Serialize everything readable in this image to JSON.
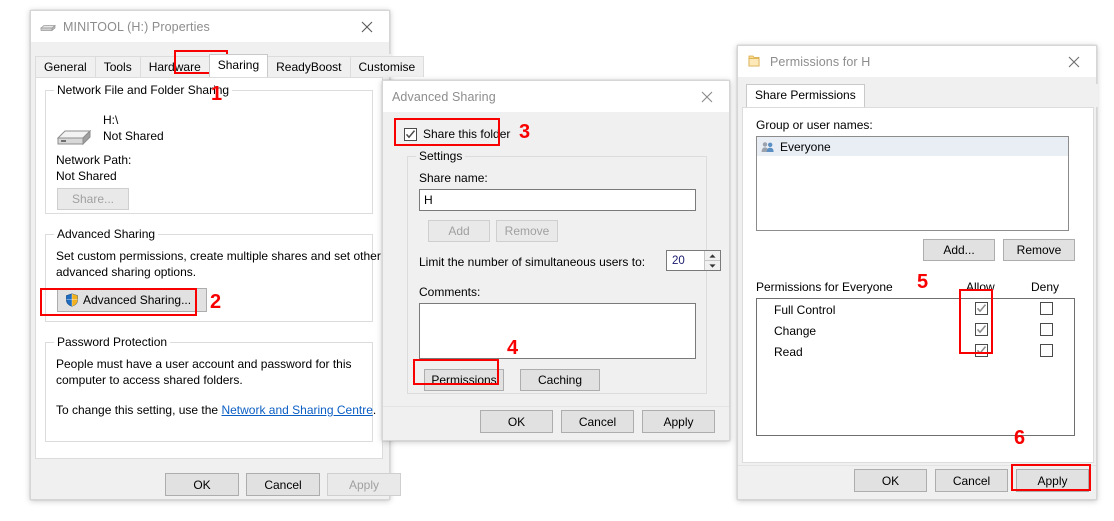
{
  "properties_window": {
    "title": "MINITOOL (H:) Properties",
    "title_icon": "drive-icon",
    "close_icon": "close-icon",
    "tabs": [
      {
        "label": "General",
        "selected": false
      },
      {
        "label": "Tools",
        "selected": false
      },
      {
        "label": "Hardware",
        "selected": false
      },
      {
        "label": "Sharing",
        "selected": true
      },
      {
        "label": "ReadyBoost",
        "selected": false
      },
      {
        "label": "Customise",
        "selected": false
      }
    ],
    "network_sharing_group": {
      "label": "Network File and Folder Sharing",
      "drive_icon": "hard-drive-icon",
      "drive_path": "H:\\",
      "drive_status": "Not Shared",
      "network_path_label": "Network Path:",
      "network_path_value": "Not Shared",
      "share_button": "Share...",
      "share_button_disabled": true
    },
    "advanced_sharing_group": {
      "label": "Advanced Sharing",
      "description_line1": "Set custom permissions, create multiple shares and set other",
      "description_line2": "advanced sharing options.",
      "button": "Advanced Sharing...",
      "button_icon": "uac-shield-icon"
    },
    "password_protection_group": {
      "label": "Password Protection",
      "description_line1": "People must have a user account and password for this",
      "description_line2": "computer to access shared folders.",
      "footer_prefix": "To change this setting, use the ",
      "footer_link": "Network and Sharing Centre",
      "footer_suffix": "."
    },
    "footer_buttons": {
      "ok": "OK",
      "cancel": "Cancel",
      "apply": "Apply",
      "apply_disabled": true
    }
  },
  "advanced_sharing_window": {
    "title": "Advanced Sharing",
    "close_icon": "close-icon",
    "share_this_folder": {
      "label": "Share this folder",
      "checked": true
    },
    "settings_group": {
      "label": "Settings",
      "share_name_label": "Share name:",
      "share_name_value": "H",
      "add_button": "Add",
      "add_disabled": true,
      "remove_button": "Remove",
      "remove_disabled": true,
      "limit_label": "Limit the number of simultaneous users to:",
      "limit_value": "20",
      "comments_label": "Comments:",
      "comments_value": "",
      "permissions_button": "Permissions",
      "caching_button": "Caching"
    },
    "footer_buttons": {
      "ok": "OK",
      "cancel": "Cancel",
      "apply": "Apply"
    }
  },
  "permissions_window": {
    "title": "Permissions for H",
    "title_icon": "folder-icon",
    "close_icon": "close-icon",
    "tabs": [
      {
        "label": "Share Permissions",
        "selected": true
      }
    ],
    "group_or_user_names_label": "Group or user names:",
    "group_list": [
      {
        "name": "Everyone",
        "icon": "users-group-icon",
        "selected": true
      }
    ],
    "add_button": "Add...",
    "remove_button": "Remove",
    "permissions_table": {
      "header_label": "Permissions for Everyone",
      "allow_header": "Allow",
      "deny_header": "Deny",
      "rows": [
        {
          "name": "Full Control",
          "allow": true,
          "deny": false
        },
        {
          "name": "Change",
          "allow": true,
          "deny": false
        },
        {
          "name": "Read",
          "allow": true,
          "deny": false
        }
      ]
    },
    "footer_buttons": {
      "ok": "OK",
      "cancel": "Cancel",
      "apply": "Apply"
    }
  },
  "annotations": {
    "markers": [
      {
        "number": "1"
      },
      {
        "number": "2"
      },
      {
        "number": "3"
      },
      {
        "number": "4"
      },
      {
        "number": "5"
      },
      {
        "number": "6"
      }
    ],
    "highlight_color": "#f90000"
  }
}
